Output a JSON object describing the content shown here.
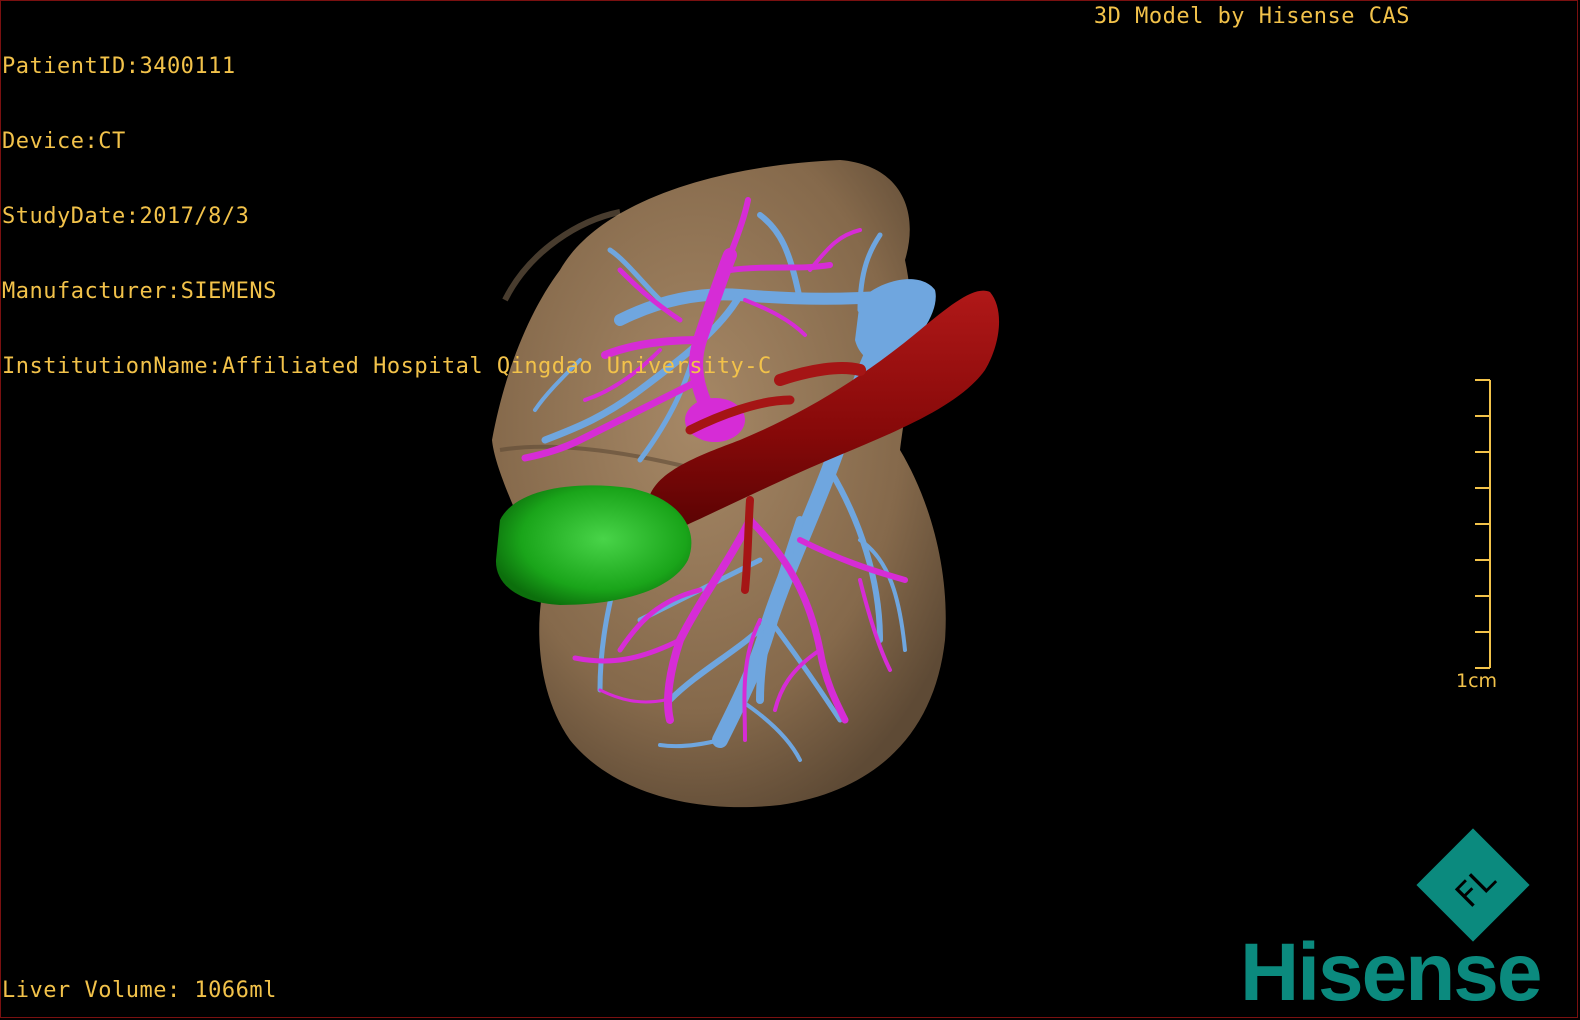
{
  "patient_info": {
    "patient_id": "PatientID:3400111",
    "device": "Device:CT",
    "study_date": "StudyDate:2017/8/3",
    "manufacturer": "Manufacturer:SIEMENS",
    "institution": "InstitutionName:Affiliated Hospital Qingdao University-C"
  },
  "brand_caption": "3D Model by Hisense CAS",
  "liver_volume": "Liver Volume: 1066ml",
  "scale_bar": {
    "label": "1cm"
  },
  "logo": {
    "badge_text": "FL",
    "word": "Hisense"
  },
  "colors": {
    "overlay_text": "#f2c24a",
    "liver": "#8e7253",
    "portal_vein": "#d62cd6",
    "hepatic_vein": "#6fa6df",
    "vena_cava": "#8e0a0a",
    "gallbladder": "#1aa51a",
    "logo": "#0b8a7e"
  }
}
